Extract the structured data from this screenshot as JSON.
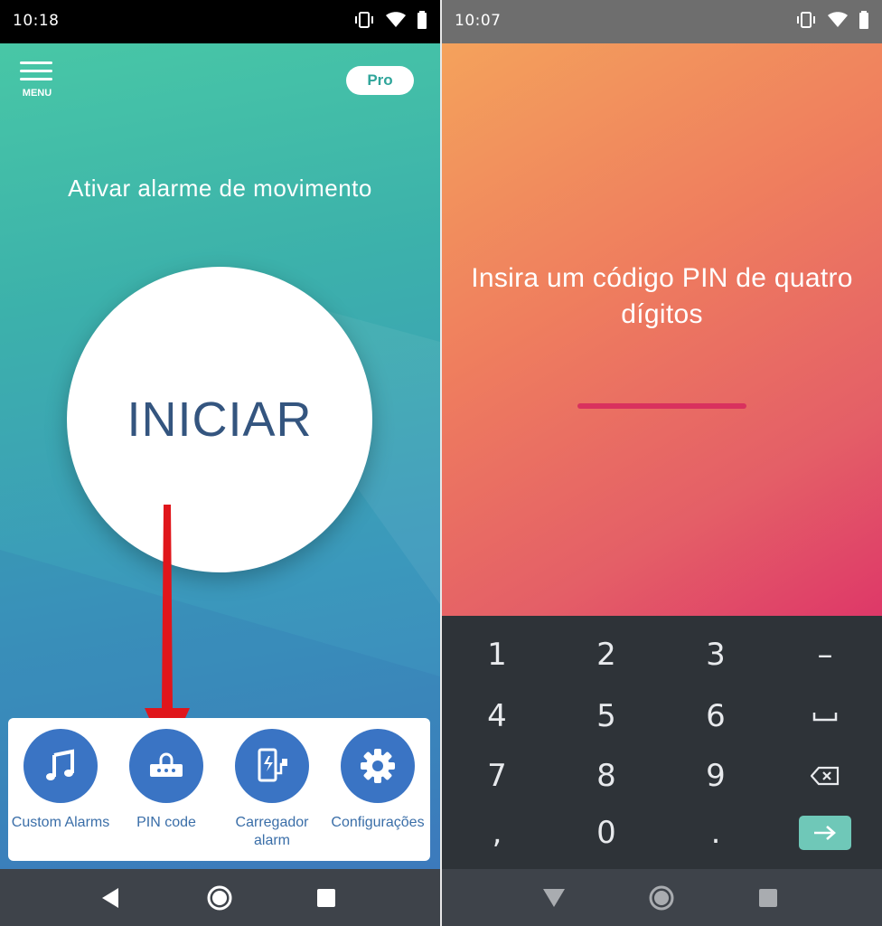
{
  "left": {
    "status": {
      "time": "10:18"
    },
    "header": {
      "menu_label": "MENU",
      "pro_label": "Pro"
    },
    "headline": "Ativar alarme de movimento",
    "start_button": "INICIAR",
    "features": [
      {
        "label": "Custom Alarms",
        "icon": "music-note-icon"
      },
      {
        "label": "PIN code",
        "icon": "pin-keypad-icon"
      },
      {
        "label": "Carregador alarm",
        "icon": "charger-icon"
      },
      {
        "label": "Configurações",
        "icon": "gear-icon"
      }
    ],
    "colors": {
      "gradient_top": "#48c7a6",
      "gradient_bottom": "#3f7fbf",
      "feature_circle": "#3a74c4",
      "arrow": "#e0161b"
    }
  },
  "right": {
    "status": {
      "time": "10:07"
    },
    "prompt": "Insira um código PIN de quatro dígitos",
    "keypad": {
      "rows": [
        [
          "1",
          "2",
          "3",
          "–"
        ],
        [
          "4",
          "5",
          "6",
          "space-key-icon"
        ],
        [
          "7",
          "8",
          "9",
          "backspace-icon"
        ],
        [
          ",",
          "0",
          ".",
          "enter-arrow-icon"
        ]
      ]
    },
    "colors": {
      "gradient_top": "#f4a25c",
      "gradient_bottom": "#de3868",
      "pin_line": "#d9315e",
      "keypad_bg": "#2e3338",
      "enter_key": "#6fc8b8"
    }
  }
}
